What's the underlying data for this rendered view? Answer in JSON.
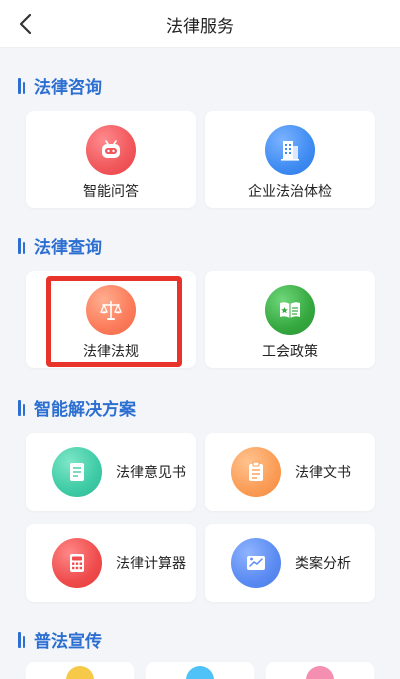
{
  "header": {
    "title": "法律服务"
  },
  "sections": [
    {
      "title": "法律咨询"
    },
    {
      "title": "法律查询"
    },
    {
      "title": "智能解决方案"
    },
    {
      "title": "普法宣传"
    }
  ],
  "consult": [
    {
      "label": "智能问答",
      "icon": "robot-icon"
    },
    {
      "label": "企业法治体检",
      "icon": "building-icon"
    }
  ],
  "query": [
    {
      "label": "法律法规",
      "icon": "scales-icon"
    },
    {
      "label": "工会政策",
      "icon": "book-icon"
    }
  ],
  "solutions": [
    {
      "label": "法律意见书",
      "icon": "document-icon"
    },
    {
      "label": "法律文书",
      "icon": "clipboard-icon"
    },
    {
      "label": "法律计算器",
      "icon": "calculator-icon"
    },
    {
      "label": "类案分析",
      "icon": "chart-icon"
    }
  ],
  "colors": {
    "accent": "#2c6fd1",
    "highlight": "#e8332a",
    "robot": "#f0575b",
    "building": "#3f8cf2",
    "scales": "#fb7b5a",
    "book": "#35a83f",
    "document": "#3ecba5",
    "clipboard": "#fb9c56",
    "calculator": "#ef4c4c",
    "chart": "#5a8bf2"
  }
}
